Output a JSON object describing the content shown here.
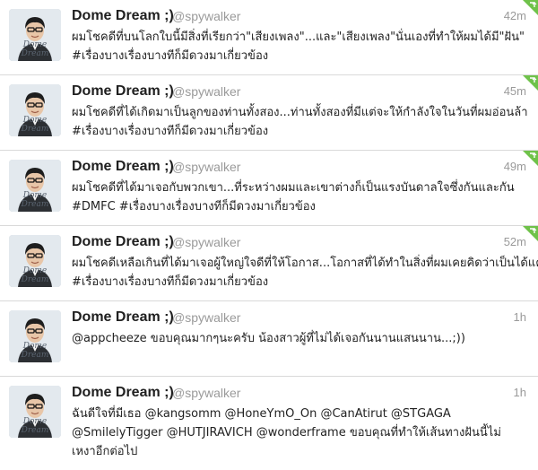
{
  "author": {
    "name": "Dome Dream ;)",
    "handle": "@spywalker",
    "avatar_caption": "Dome Dream"
  },
  "tweets": [
    {
      "time": "42m",
      "corner": true,
      "lines": [
        "ผมโชคดีที่บนโลกใบนี้มีสิ่งที่เรียกว่า\"เสียงเพลง\"...และ\"เสียงเพลง\"นั่นเองที่ทำให้ผมได้มี\"ฝัน\"",
        "#เรื่องบางเรื่องบางทีก็มีดวงมาเกี่ยวข้อง"
      ]
    },
    {
      "time": "45m",
      "corner": true,
      "lines": [
        "ผมโชคดีที่ได้เกิดมาเป็นลูกของท่านทั้งสอง...ท่านทั้งสองที่มีแต่จะให้กำลังใจในวันที่ผมอ่อนล้า",
        "#เรื่องบางเรื่องบางทีก็มีดวงมาเกี่ยวข้อง"
      ]
    },
    {
      "time": "49m",
      "corner": true,
      "lines": [
        "ผมโชคดีที่ได้มาเจอกับพวกเขา...ที่ระหว่างผมและเขาต่างก็เป็นแรงบันดาลใจซึ่งกันและกัน",
        "#DMFC #เรื่องบางเรื่องบางทีก็มีดวงมาเกี่ยวข้อง"
      ]
    },
    {
      "time": "52m",
      "corner": true,
      "lines": [
        "ผมโชคดีเหลือเกินที่ได้มาเจอผู้ใหญ่ใจดีที่ให้โอกาส...โอกาสที่ได้ทำในสิ่งที่ผมเคยคิดว่าเป็นได้แค่ฝัน",
        "#เรื่องบางเรื่องบางทีก็มีดวงมาเกี่ยวข้อง"
      ]
    },
    {
      "time": "1h",
      "corner": false,
      "lines": [
        "@appcheeze ขอบคุณมากๆนะครับ น้องสาวผู้ที่ไม่ได้เจอกันนานแสนนาน...;))"
      ]
    },
    {
      "time": "1h",
      "corner": false,
      "lines": [
        "ฉันดีใจที่มีเธอ @kangsomm @HoneYmO_On @CanAtirut @STGAGA",
        "@SmilelyTigger @HUTJIRAVICH @wonderframe ขอบคุณที่ทำให้เส้นทางฝันนี้ไม่",
        "เหงาอีกต่อไป"
      ]
    }
  ],
  "colors": {
    "corner": "#6fc24a",
    "time": "#9a9a9a",
    "handle": "#9a9a9a"
  }
}
